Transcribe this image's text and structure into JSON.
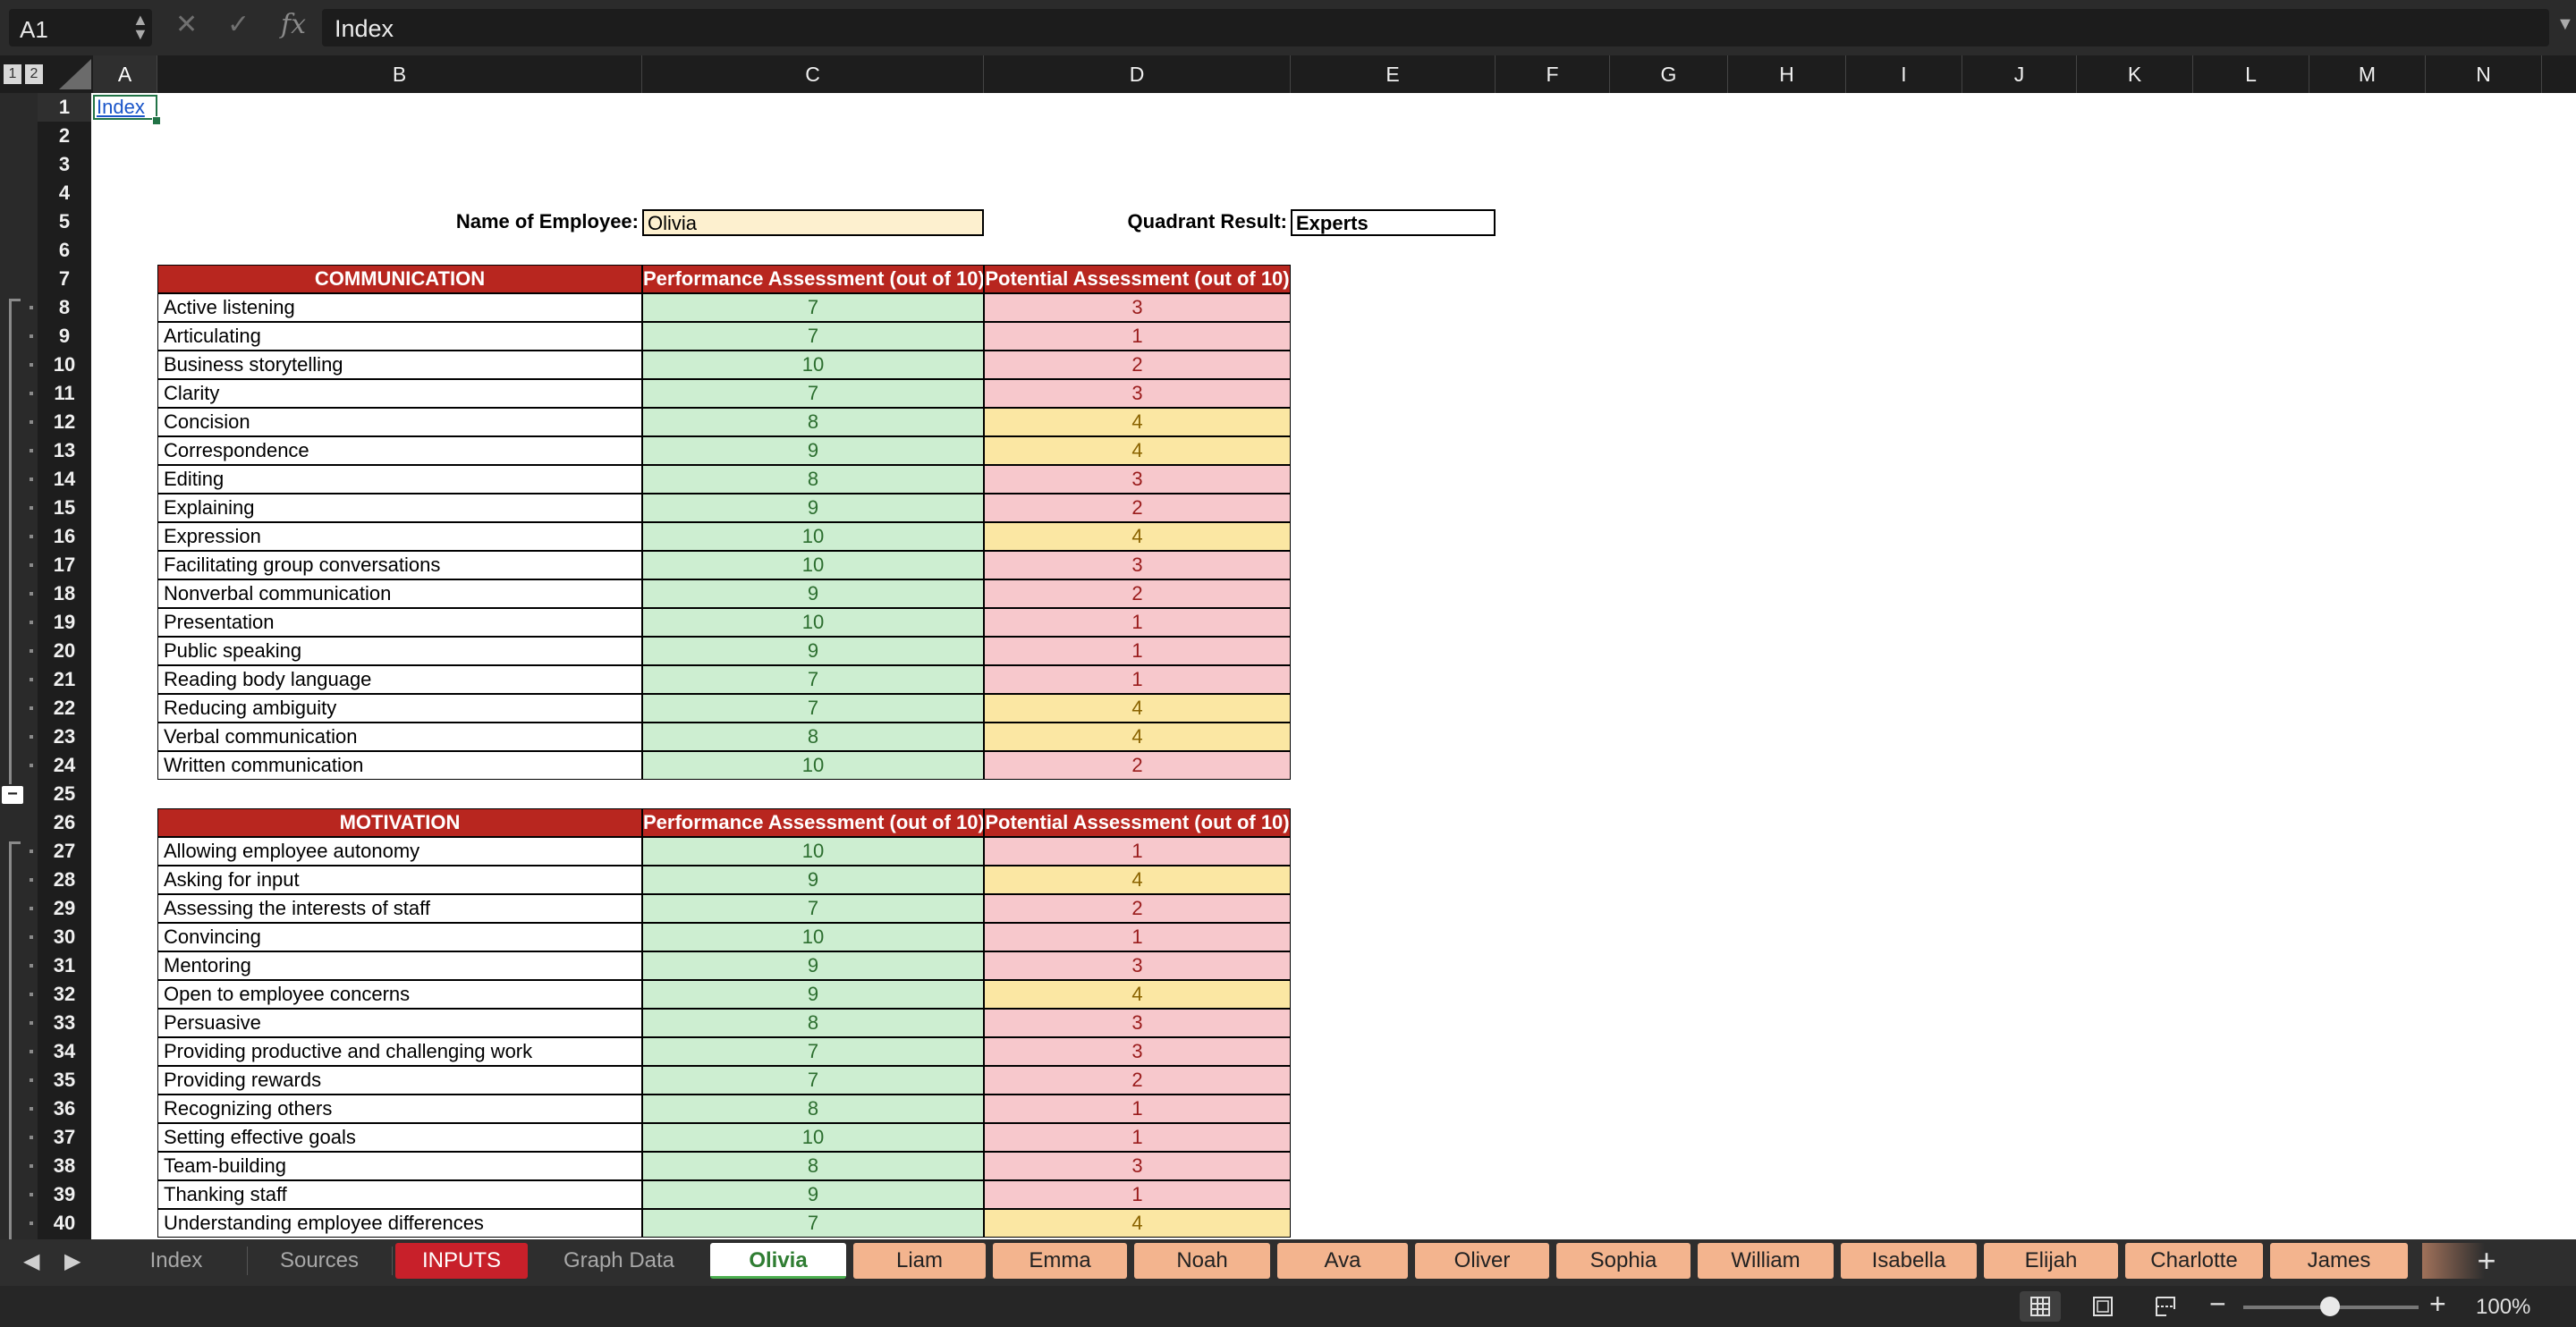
{
  "formula_bar": {
    "name_box": "A1",
    "formula": "Index",
    "cancel_icon": "x-icon",
    "confirm_icon": "check-icon",
    "fx_label": "fx"
  },
  "outline_levels": [
    "1",
    "2"
  ],
  "columns": [
    "A",
    "B",
    "C",
    "D",
    "E",
    "F",
    "G",
    "H",
    "I",
    "J",
    "K",
    "L",
    "M",
    "N"
  ],
  "rows": [
    "1",
    "2",
    "3",
    "4",
    "5",
    "6",
    "7",
    "8",
    "9",
    "10",
    "11",
    "12",
    "13",
    "14",
    "15",
    "16",
    "17",
    "18",
    "19",
    "20",
    "21",
    "22",
    "23",
    "24",
    "25",
    "26",
    "27",
    "28",
    "29",
    "30",
    "31",
    "32",
    "33",
    "34",
    "35",
    "36",
    "37",
    "38",
    "39",
    "40"
  ],
  "sheet": {
    "a1_link": "Index",
    "employee_label": "Name of Employee:",
    "employee_name": "Olivia",
    "quadrant_label": "Quadrant Result:",
    "quadrant_value": "Experts",
    "perf_header": "Performance Assessment (out of 10)",
    "pot_header": "Potential Assessment (out of 10)",
    "communication": {
      "title": "COMMUNICATION",
      "rows": [
        {
          "skill": "Active listening",
          "perf": "7",
          "pot": "3"
        },
        {
          "skill": "Articulating",
          "perf": "7",
          "pot": "1"
        },
        {
          "skill": "Business storytelling",
          "perf": "10",
          "pot": "2"
        },
        {
          "skill": "Clarity",
          "perf": "7",
          "pot": "3"
        },
        {
          "skill": "Concision",
          "perf": "8",
          "pot": "4"
        },
        {
          "skill": "Correspondence",
          "perf": "9",
          "pot": "4"
        },
        {
          "skill": "Editing",
          "perf": "8",
          "pot": "3"
        },
        {
          "skill": "Explaining",
          "perf": "9",
          "pot": "2"
        },
        {
          "skill": "Expression",
          "perf": "10",
          "pot": "4"
        },
        {
          "skill": "Facilitating group conversations",
          "perf": "10",
          "pot": "3"
        },
        {
          "skill": "Nonverbal communication",
          "perf": "9",
          "pot": "2"
        },
        {
          "skill": "Presentation",
          "perf": "10",
          "pot": "1"
        },
        {
          "skill": "Public speaking",
          "perf": "9",
          "pot": "1"
        },
        {
          "skill": "Reading body language",
          "perf": "7",
          "pot": "1"
        },
        {
          "skill": "Reducing ambiguity",
          "perf": "7",
          "pot": "4"
        },
        {
          "skill": "Verbal communication",
          "perf": "8",
          "pot": "4"
        },
        {
          "skill": "Written communication",
          "perf": "10",
          "pot": "2"
        }
      ]
    },
    "motivation": {
      "title": "MOTIVATION",
      "rows": [
        {
          "skill": "Allowing employee autonomy",
          "perf": "10",
          "pot": "1"
        },
        {
          "skill": "Asking for input",
          "perf": "9",
          "pot": "4"
        },
        {
          "skill": "Assessing the interests of staff",
          "perf": "7",
          "pot": "2"
        },
        {
          "skill": "Convincing",
          "perf": "10",
          "pot": "1"
        },
        {
          "skill": "Mentoring",
          "perf": "9",
          "pot": "3"
        },
        {
          "skill": "Open to employee concerns",
          "perf": "9",
          "pot": "4"
        },
        {
          "skill": "Persuasive",
          "perf": "8",
          "pot": "3"
        },
        {
          "skill": "Providing productive and challenging work",
          "perf": "7",
          "pot": "3"
        },
        {
          "skill": "Providing rewards",
          "perf": "7",
          "pot": "2"
        },
        {
          "skill": "Recognizing others",
          "perf": "8",
          "pot": "1"
        },
        {
          "skill": "Setting effective goals",
          "perf": "10",
          "pot": "1"
        },
        {
          "skill": "Team-building",
          "perf": "8",
          "pot": "3"
        },
        {
          "skill": "Thanking staff",
          "perf": "9",
          "pot": "1"
        },
        {
          "skill": "Understanding employee differences",
          "perf": "7",
          "pot": "4"
        }
      ]
    }
  },
  "tabs": [
    {
      "label": "Index",
      "style": "gray"
    },
    {
      "label": "Sources",
      "style": "gray"
    },
    {
      "label": "INPUTS",
      "style": "red"
    },
    {
      "label": "Graph Data",
      "style": "gray"
    },
    {
      "label": "Olivia",
      "style": "active"
    },
    {
      "label": "Liam",
      "style": "orange"
    },
    {
      "label": "Emma",
      "style": "orange"
    },
    {
      "label": "Noah",
      "style": "orange"
    },
    {
      "label": "Ava",
      "style": "orange"
    },
    {
      "label": "Oliver",
      "style": "orange"
    },
    {
      "label": "Sophia",
      "style": "orange"
    },
    {
      "label": "William",
      "style": "orange"
    },
    {
      "label": "Isabella",
      "style": "orange"
    },
    {
      "label": "Elijah",
      "style": "orange"
    },
    {
      "label": "Charlotte",
      "style": "orange"
    },
    {
      "label": "James",
      "style": "orange"
    }
  ],
  "status_bar": {
    "zoom": "100%",
    "views": [
      "normal-view-icon",
      "page-layout-icon",
      "page-break-icon"
    ]
  },
  "colors": {
    "header_red": "#b8261f",
    "perf_green": "#cdeed1",
    "pot_red": "#f7c8cc",
    "pot_yellow": "#fbe7a3",
    "tab_orange": "#f3b48e",
    "tab_red": "#c8202a"
  }
}
